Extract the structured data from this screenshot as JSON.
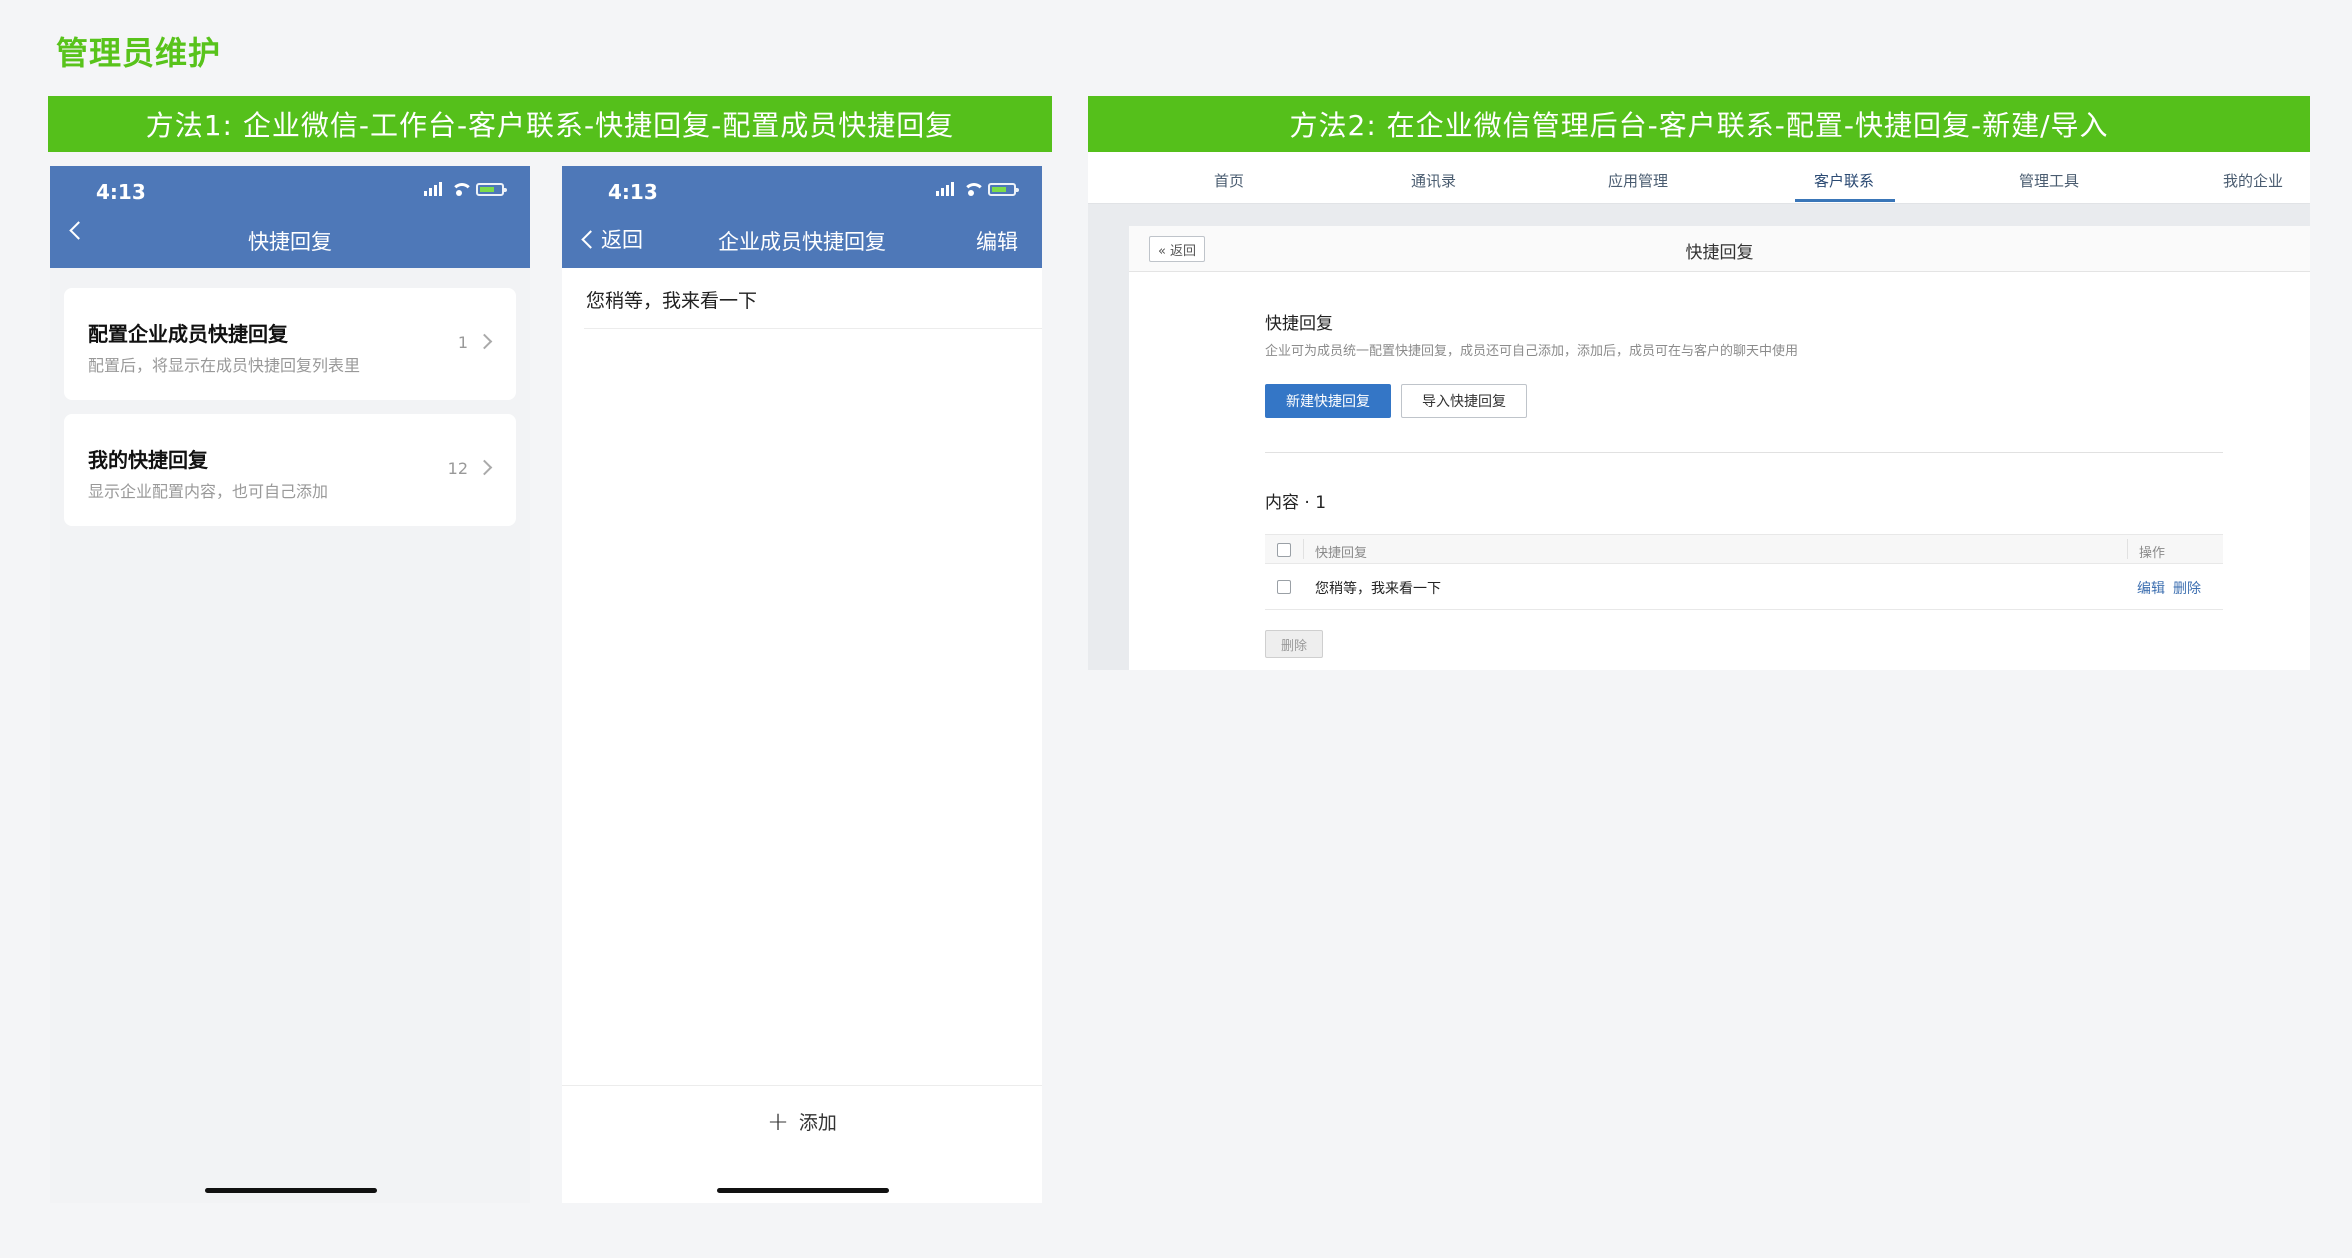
{
  "page_title": "管理员维护",
  "banners": {
    "method1": "方法1: 企业微信-工作台-客户联系-快捷回复-配置成员快捷回复",
    "method2": "方法2: 在企业微信管理后台-客户联系-配置-快捷回复-新建/导入"
  },
  "phone1": {
    "time": "4:13",
    "title": "快捷回复",
    "cards": [
      {
        "title": "配置企业成员快捷回复",
        "subtitle": "配置后，将显示在成员快捷回复列表里",
        "count": "1"
      },
      {
        "title": "我的快捷回复",
        "subtitle": "显示企业配置内容，也可自己添加",
        "count": "12"
      }
    ]
  },
  "phone2": {
    "time": "4:13",
    "back_label": "返回",
    "title": "企业成员快捷回复",
    "edit_label": "编辑",
    "reply_text": "您稍等，我来看一下",
    "add_label": "添加"
  },
  "console": {
    "nav": [
      "首页",
      "通讯录",
      "应用管理",
      "客户联系",
      "管理工具",
      "我的企业"
    ],
    "active_nav": "客户联系",
    "back_label": "« 返回",
    "panel_title": "快捷回复",
    "section_title": "快捷回复",
    "section_desc": "企业可为成员统一配置快捷回复，成员还可自己添加，添加后，成员可在与客户的聊天中使用",
    "new_button": "新建快捷回复",
    "import_button": "导入快捷回复",
    "content_count": "内容 · 1",
    "table": {
      "headers": [
        "快捷回复",
        "操作"
      ],
      "rows": [
        {
          "text": "您稍等，我来看一下",
          "actions": [
            "编辑",
            "删除"
          ]
        }
      ]
    },
    "delete_button": "删除"
  },
  "colors": {
    "accent_green": "#55c01b",
    "phone_header_blue": "#4e78b8",
    "primary_button_blue": "#3476c6"
  }
}
